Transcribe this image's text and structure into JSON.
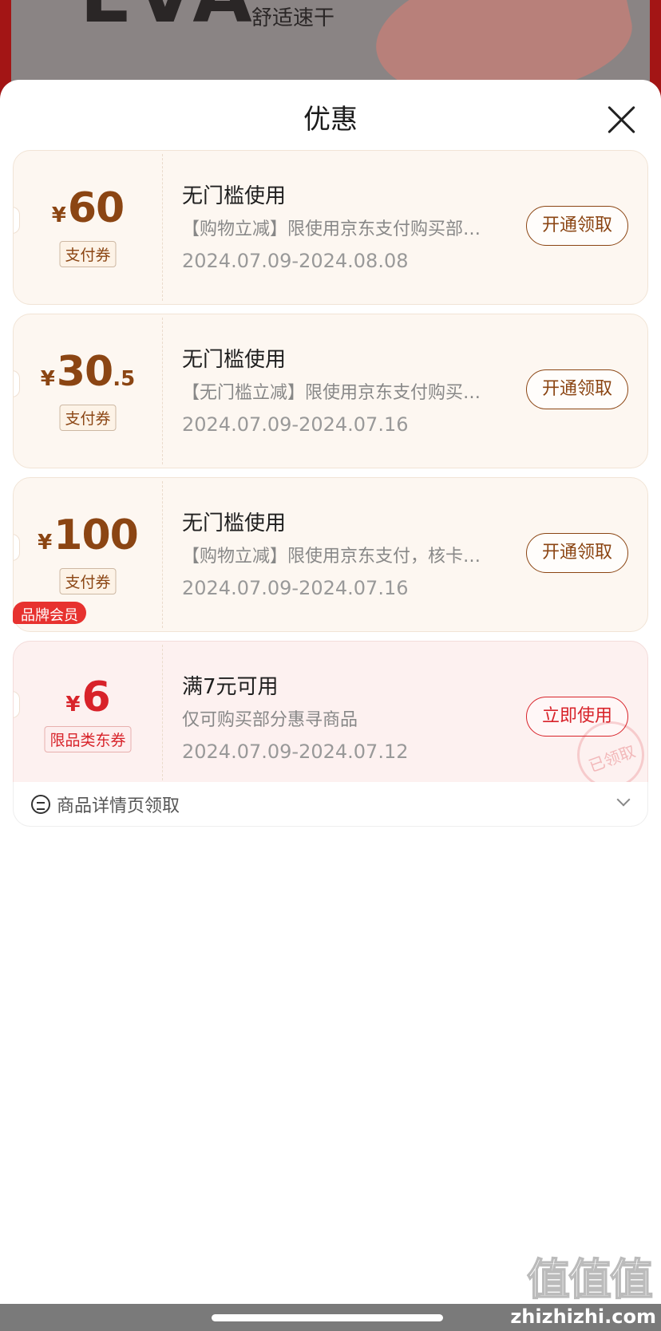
{
  "backdrop": {
    "brand_text": "EVA",
    "slogan": "舒适速干"
  },
  "sheet": {
    "title": "优惠",
    "close_label": ""
  },
  "coupons": [
    {
      "currency": "¥",
      "amount": "60",
      "amount_decimal": "",
      "type_tag": "支付券",
      "title": "无门槛使用",
      "description": "【购物立减】限使用京东支付购买部…",
      "date_range": "2024.07.09-2024.08.08",
      "action_label": "开通领取"
    },
    {
      "currency": "¥",
      "amount": "30",
      "amount_decimal": ".5",
      "type_tag": "支付券",
      "title": "无门槛使用",
      "description": "【无门槛立减】限使用京东支付购买…",
      "date_range": "2024.07.09-2024.07.16",
      "action_label": "开通领取"
    },
    {
      "currency": "¥",
      "amount": "100",
      "amount_decimal": "",
      "type_tag": "支付券",
      "title": "无门槛使用",
      "description": "【购物立减】限使用京东支付，核卡…",
      "date_range": "2024.07.09-2024.07.16",
      "action_label": "开通领取"
    },
    {
      "badge": "品牌会员",
      "currency": "¥",
      "amount": "6",
      "amount_decimal": "",
      "type_tag": "限品类东券",
      "title": "满7元可用",
      "description": "仅可购买部分惠寻商品",
      "date_range": "2024.07.09-2024.07.12",
      "action_label": "立即使用",
      "stamp": "已领取",
      "source_text": "商品详情页领取"
    }
  ],
  "watermark": {
    "glyphs": "值值值",
    "url": "zhizhizhi.com"
  },
  "colors": {
    "brown": "#8b4513",
    "red": "#d8232a",
    "badge_red": "#e7322f",
    "coupon_bg": "#fdf7f1"
  }
}
